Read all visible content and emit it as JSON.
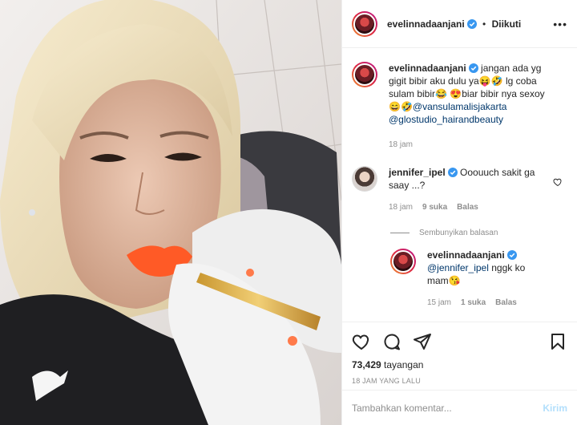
{
  "header": {
    "username": "evelinnadaanjani",
    "separator": "•",
    "follow_status": "Diikuti"
  },
  "caption": {
    "username": "evelinnadaanjani",
    "text_1": "jangan ada yg gigit bibir aku dulu ya😝🤣",
    "text_2": "lg coba sulam bibir😂 😍biar bibir nya sexoy😄🤣",
    "mention_1": "@vansulamalisjakarta",
    "mention_2": "@glostudio_hairandbeauty",
    "time": "18 jam"
  },
  "comment": {
    "username": "jennifer_ipel",
    "text": "Ooouuch sakit ga saay ...?",
    "time": "18 jam",
    "likes": "9 suka",
    "reply_label": "Balas"
  },
  "hide_replies": "Sembunyikan balasan",
  "reply": {
    "username": "evelinnadaanjani",
    "mention": "@jennifer_ipel",
    "text": "nggk ko mam😘",
    "time": "15 jam",
    "likes": "1 suka",
    "reply_label": "Balas"
  },
  "stats": {
    "views_count": "73,429",
    "views_label": "tayangan",
    "posted": "18 JAM YANG LALU"
  },
  "composer": {
    "placeholder": "Tambahkan komentar...",
    "post_label": "Kirim"
  },
  "colors": {
    "link": "#00376b",
    "muted": "#8e8e8e",
    "verified": "#3897f0",
    "post_disabled": "#b2dffc"
  }
}
